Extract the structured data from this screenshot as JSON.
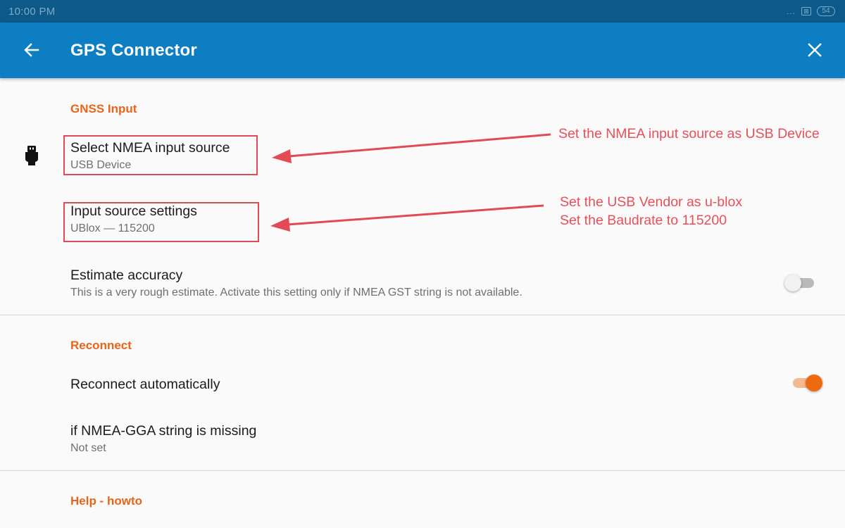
{
  "status_bar": {
    "time": "10:00 PM",
    "dots": "...",
    "sim": "⊠",
    "battery": "54"
  },
  "app_bar": {
    "title": "GPS Connector",
    "back_icon": "arrow-back-icon",
    "close_icon": "close-icon"
  },
  "sections": {
    "gnss": {
      "title": "GNSS Input"
    },
    "reconnect": {
      "title": "Reconnect"
    },
    "help": {
      "title": "Help - howto"
    }
  },
  "items": {
    "nmea_source": {
      "title": "Select NMEA input source",
      "summary": "USB Device",
      "icon": "usb-plug-icon"
    },
    "source_settings": {
      "title": "Input source settings",
      "summary": "UBlox — 115200"
    },
    "estimate_accuracy": {
      "title": "Estimate accuracy",
      "summary": "This is a very rough estimate. Activate this setting only if NMEA GST string is not available.",
      "enabled": false
    },
    "reconnect_auto": {
      "title": "Reconnect automatically",
      "enabled": true
    },
    "gga_missing": {
      "title": "if NMEA-GGA string is missing",
      "summary": "Not set"
    }
  },
  "annotations": {
    "source_note": "Set the NMEA input source as USB Device",
    "settings_note_line1": "Set the USB Vendor as u-blox",
    "settings_note_line2": "Set the Baudrate to 115200"
  },
  "colors": {
    "status_bar": "#0d5a8a",
    "app_bar": "#0d7ec2",
    "section_accent": "#e8641a",
    "annotation_red": "#e24a55",
    "toggle_on": "#ee6a12"
  }
}
